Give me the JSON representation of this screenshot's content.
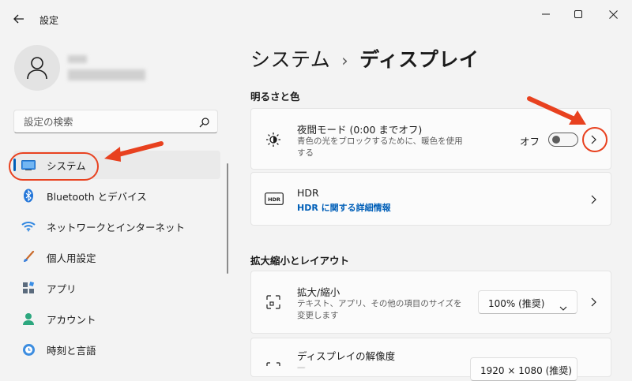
{
  "window": {
    "title": "設定",
    "icons": {
      "back": "back-arrow-icon",
      "minimize": "minimize-icon",
      "maximize": "maximize-icon",
      "close": "close-icon"
    }
  },
  "sidebar": {
    "search_placeholder": "設定の検索",
    "items": [
      {
        "label": "システム",
        "icon": "system-display-icon",
        "selected": true
      },
      {
        "label": "Bluetooth とデバイス",
        "icon": "bluetooth-icon"
      },
      {
        "label": "ネットワークとインターネット",
        "icon": "wifi-icon"
      },
      {
        "label": "個人用設定",
        "icon": "brush-icon"
      },
      {
        "label": "アプリ",
        "icon": "apps-icon"
      },
      {
        "label": "アカウント",
        "icon": "account-icon"
      },
      {
        "label": "時刻と言語",
        "icon": "time-language-icon"
      }
    ]
  },
  "main": {
    "breadcrumb": {
      "parent": "システム",
      "separator": "›",
      "current": "ディスプレイ"
    },
    "sections": {
      "brightness_title": "明るさと色",
      "scale_title": "拡大縮小とレイアウト"
    },
    "night_light": {
      "title": "夜間モード (0:00 までオフ)",
      "description": "青色の光をブロックするために、暖色を使用する",
      "toggle_label": "オフ",
      "toggle_on": false
    },
    "hdr": {
      "title": "HDR",
      "link": "HDR に関する詳細情報"
    },
    "scale": {
      "title": "拡大/縮小",
      "description": "テキスト、アプリ、その他の項目のサイズを変更します",
      "value": "100% (推奨)"
    },
    "resolution": {
      "title": "ディスプレイの解像度",
      "value": "1920 × 1080 (推奨)"
    }
  },
  "colors": {
    "accent": "#005fb8",
    "annotation": "#e8411f"
  }
}
